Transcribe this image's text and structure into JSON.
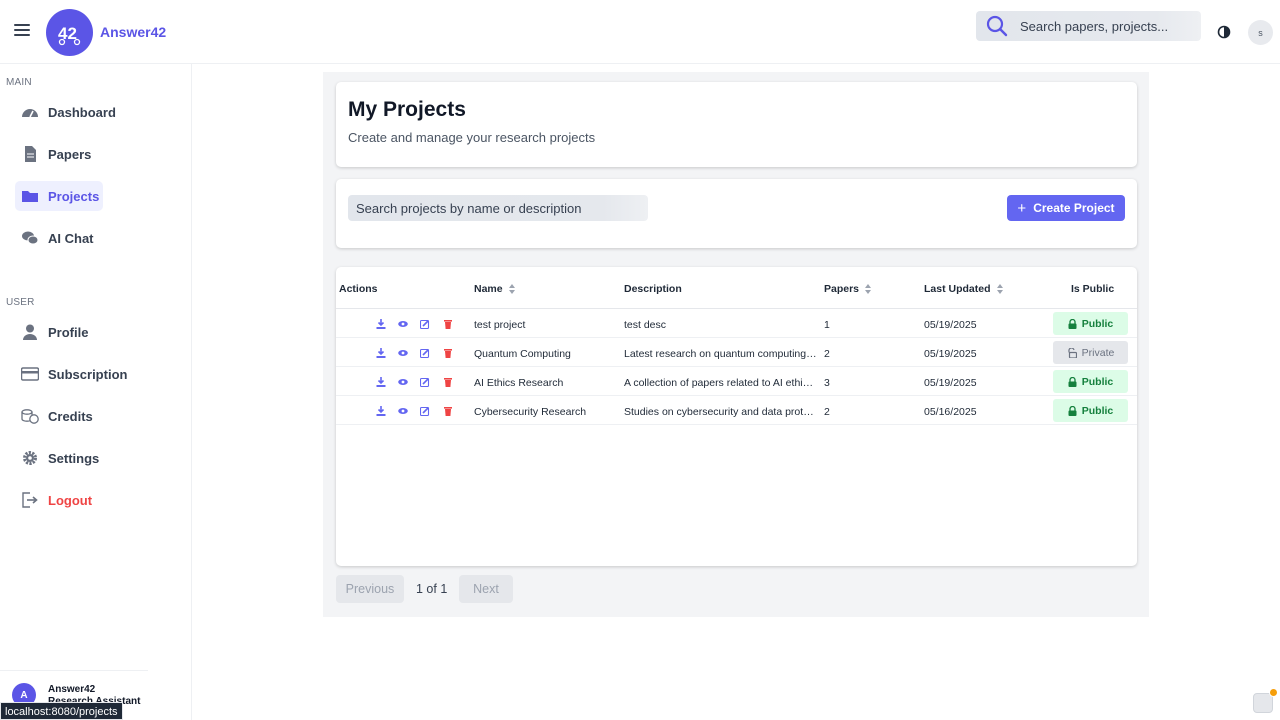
{
  "app": {
    "brand": "Answer42"
  },
  "header": {
    "search_placeholder": "Search papers, projects...",
    "user_initial": "s"
  },
  "sidebar": {
    "main_label": "MAIN",
    "user_label": "USER",
    "main_items": [
      {
        "label": "Dashboard",
        "icon": "dashboard-icon"
      },
      {
        "label": "Papers",
        "icon": "paper-icon"
      },
      {
        "label": "Projects",
        "icon": "folder-icon",
        "active": true
      },
      {
        "label": "AI Chat",
        "icon": "chat-icon"
      }
    ],
    "user_items": [
      {
        "label": "Profile",
        "icon": "user-icon"
      },
      {
        "label": "Subscription",
        "icon": "credit-card-icon"
      },
      {
        "label": "Credits",
        "icon": "coins-icon"
      },
      {
        "label": "Settings",
        "icon": "gear-icon"
      },
      {
        "label": "Logout",
        "icon": "logout-icon"
      }
    ],
    "footer": {
      "avatar_initial": "A",
      "name": "Answer42",
      "role": "Research Assistant"
    }
  },
  "page": {
    "title": "My Projects",
    "subtitle": "Create and manage your research projects",
    "search_placeholder": "Search projects by name or description",
    "create_label": "Create Project"
  },
  "table": {
    "headers": {
      "actions": "Actions",
      "name": "Name",
      "description": "Description",
      "papers": "Papers",
      "last_updated": "Last Updated",
      "is_public": "Is Public"
    },
    "rows": [
      {
        "name": "test project",
        "description": "test desc",
        "papers": "1",
        "last_updated": "05/19/2025",
        "visibility": "Public"
      },
      {
        "name": "Quantum Computing",
        "description": "Latest research on quantum computing a...",
        "papers": "2",
        "last_updated": "05/19/2025",
        "visibility": "Private"
      },
      {
        "name": "AI Ethics Research",
        "description": "A collection of papers related to AI ethics...",
        "papers": "3",
        "last_updated": "05/19/2025",
        "visibility": "Public"
      },
      {
        "name": "Cybersecurity Research",
        "description": "Studies on cybersecurity and data protec...",
        "papers": "2",
        "last_updated": "05/16/2025",
        "visibility": "Public"
      }
    ]
  },
  "pagination": {
    "previous": "Previous",
    "info": "1 of 1",
    "next": "Next"
  },
  "statusbar": {
    "url": "localhost:8080/projects"
  },
  "colors": {
    "accent": "#5b55e6",
    "button": "#6366f1",
    "public_bg": "#dcfce7",
    "public_text": "#15803d",
    "logout": "#ef4444"
  }
}
